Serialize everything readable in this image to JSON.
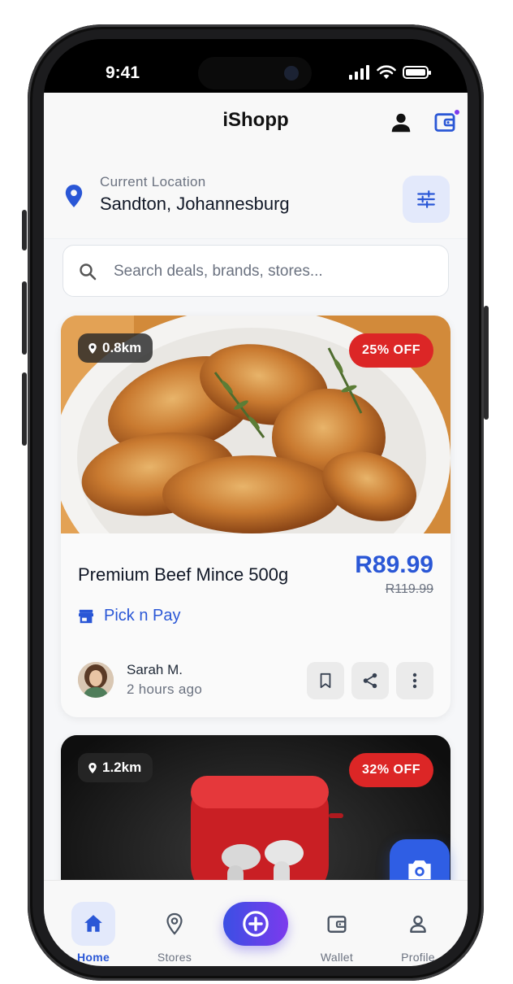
{
  "status_bar": {
    "time": "9:41"
  },
  "header": {
    "title": "iShopp"
  },
  "location": {
    "label": "Current Location",
    "value": "Sandton, Johannesburg"
  },
  "search": {
    "placeholder": "Search deals, brands, stores..."
  },
  "deals": [
    {
      "distance": "0.8km",
      "discount": "25% OFF",
      "title": "Premium Beef Mince 500g",
      "price": "R89.99",
      "old_price": "R119.99",
      "store": "Pick n Pay",
      "poster_name": "Sarah M.",
      "posted": "2 hours ago"
    },
    {
      "distance": "1.2km",
      "discount": "32% OFF"
    }
  ],
  "nav": [
    {
      "label": "Home",
      "icon": "home-icon",
      "active": true
    },
    {
      "label": "Stores",
      "icon": "pin-icon"
    },
    {
      "label": "",
      "icon": "add-icon"
    },
    {
      "label": "Wallet",
      "icon": "wallet-icon"
    },
    {
      "label": "Profile",
      "icon": "profile-icon"
    }
  ],
  "colors": {
    "accent": "#2a57d6",
    "discount": "#dc2626",
    "fab": "#2f5ee4",
    "gradient_start": "#3b4fe4",
    "gradient_end": "#7c3aed"
  }
}
